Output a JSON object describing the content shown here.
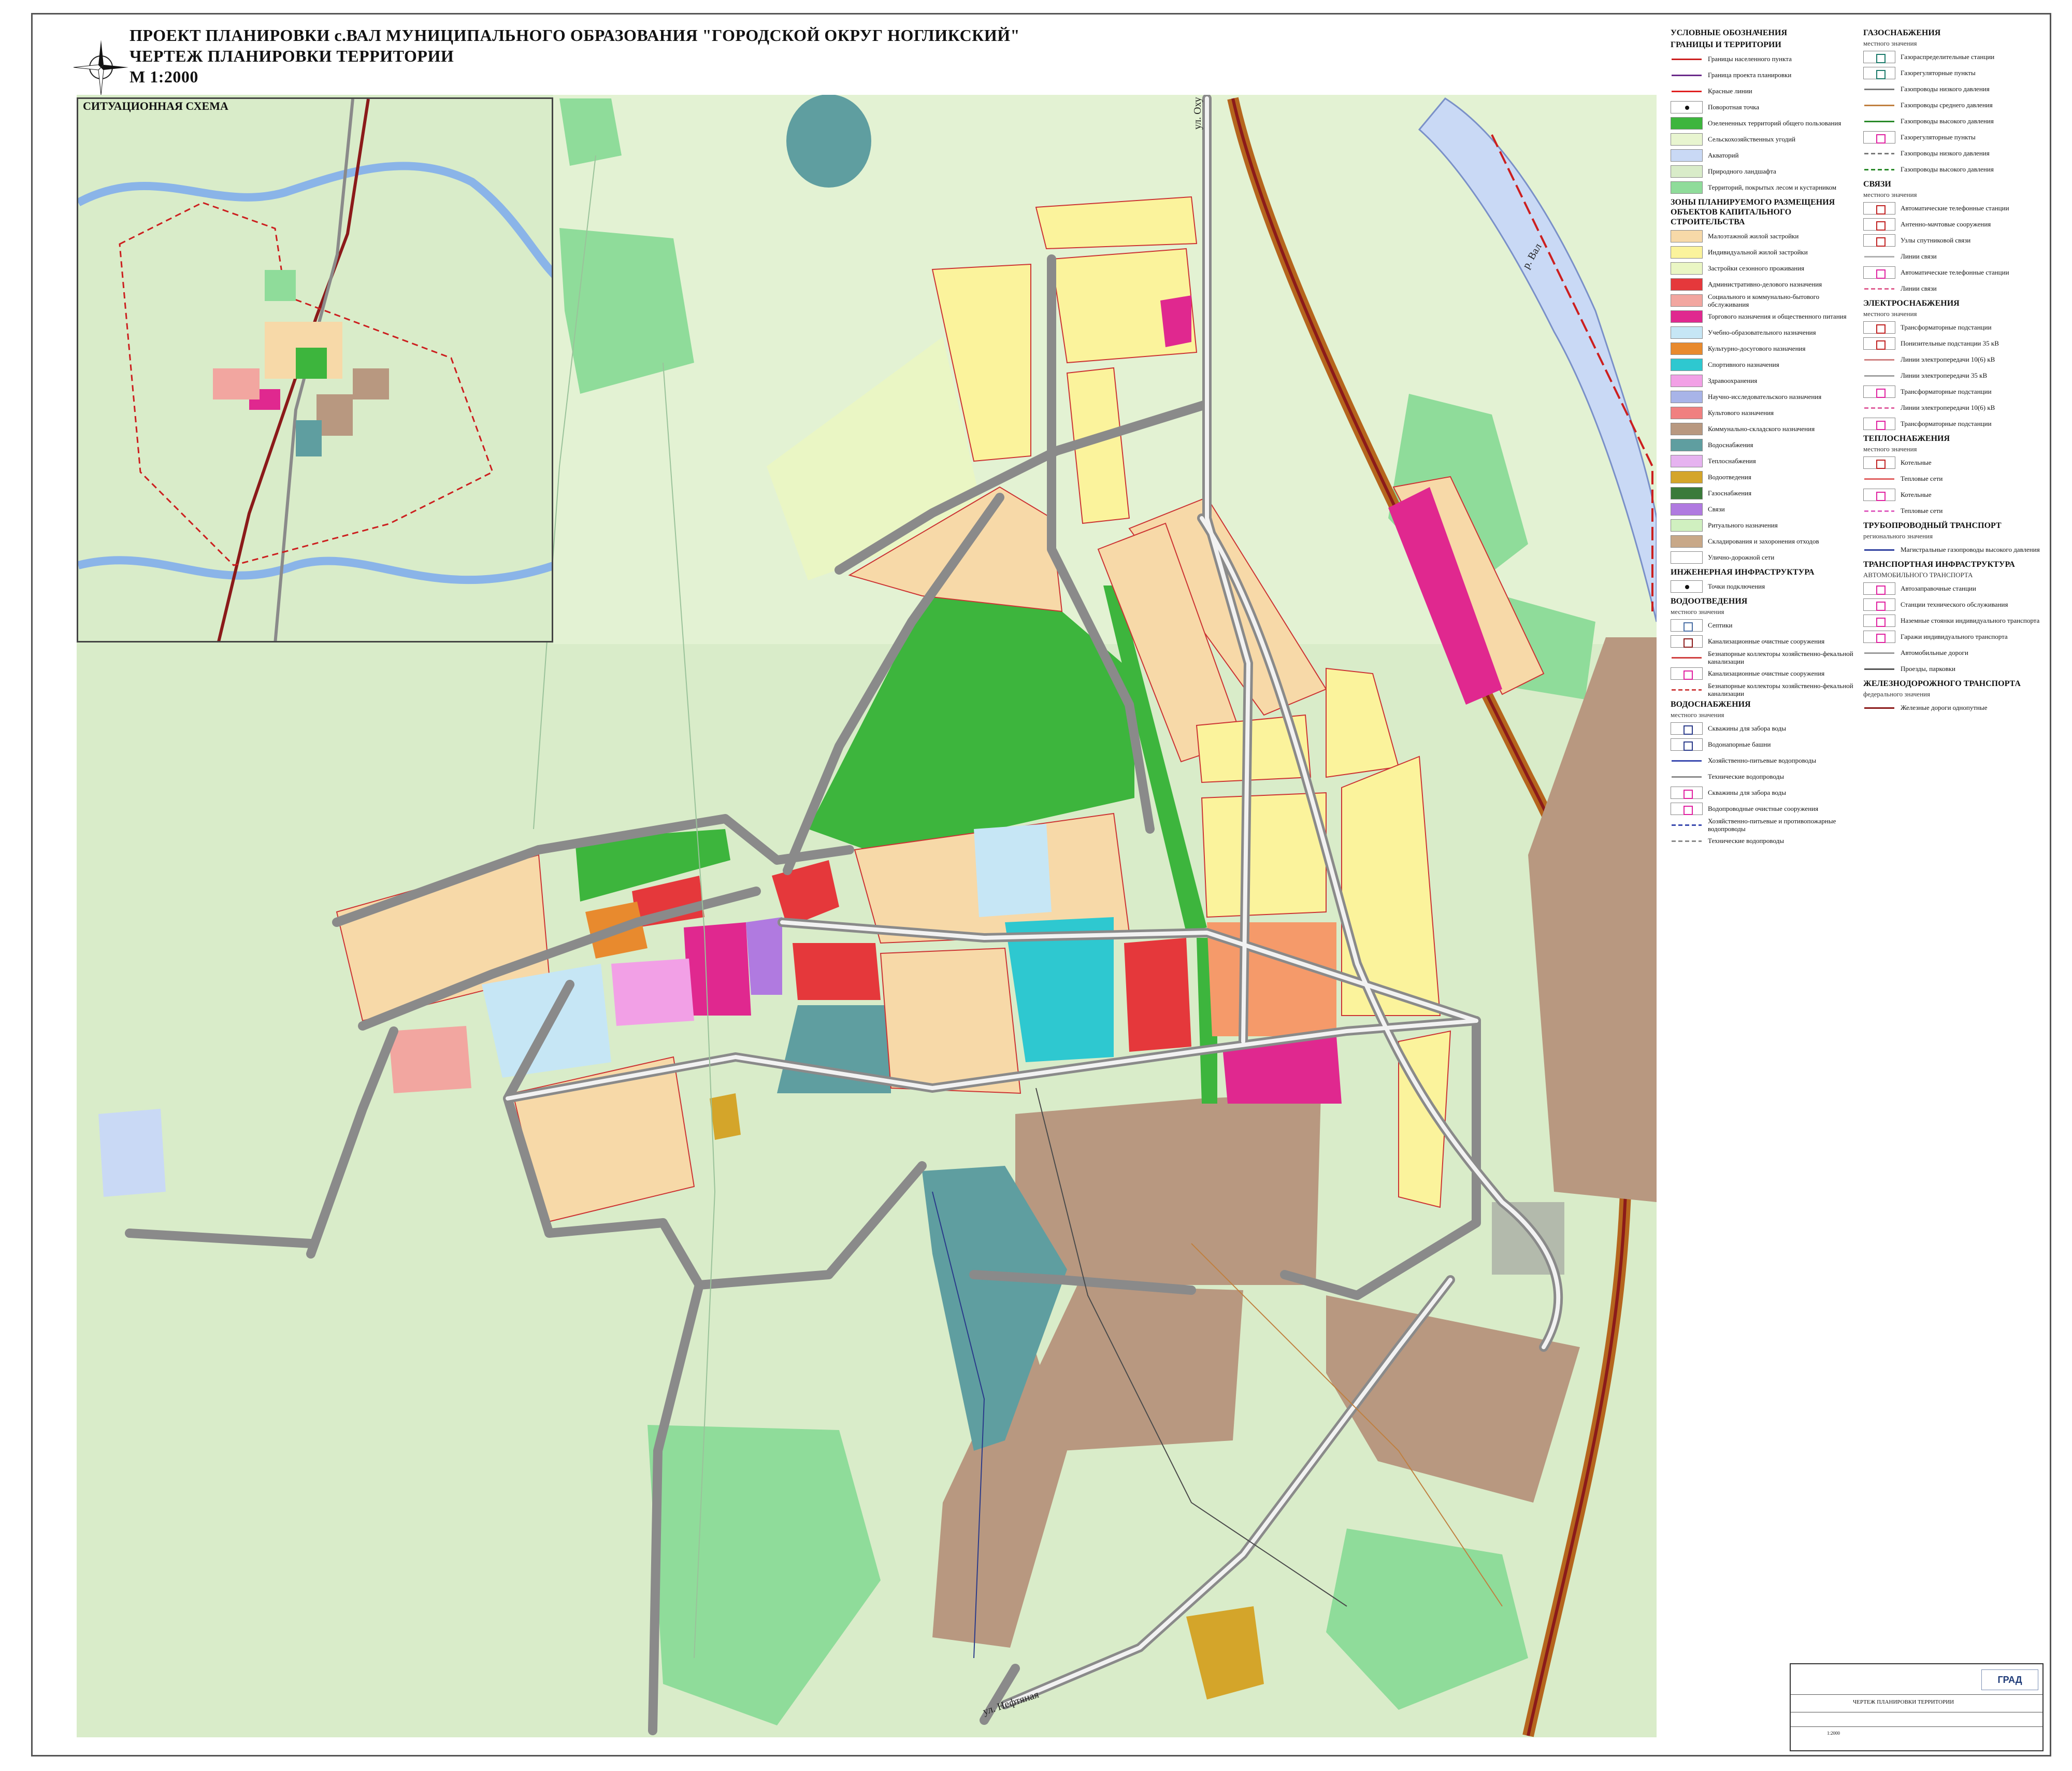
{
  "title": {
    "line1": "ПРОЕКТ ПЛАНИРОВКИ с.ВАЛ МУНИЦИПАЛЬНОГО ОБРАЗОВАНИЯ \"ГОРОДСКОЙ ОКРУГ НОГЛИКСКИЙ\"",
    "line2": "ЧЕРТЕЖ ПЛАНИРОВКИ ТЕРРИТОРИИ",
    "line3": "М 1:2000"
  },
  "inset": {
    "label": "СИТУАЦИОННАЯ СХЕМА"
  },
  "map_labels": {
    "road_north": "ул. Оху",
    "road_south": "ул. Нефтяная",
    "river": "р. Вал"
  },
  "legend": {
    "title": "УСЛОВНЫЕ ОБОЗНАЧЕНИЯ",
    "sections": [
      {
        "heading": "ГРАНИЦЫ И ТЕРРИТОРИИ",
        "items": [
          {
            "label": "Границы населенного пункта",
            "kind": "line",
            "color": "#cc1f1f"
          },
          {
            "label": "Граница проекта планировки",
            "kind": "line",
            "color": "#6a2a8a"
          },
          {
            "label": "Красные линии",
            "kind": "line",
            "color": "#e02020"
          },
          {
            "label": "Поворотная точка",
            "kind": "dot",
            "color": "#111111"
          },
          {
            "label": "Озелененных территорий общего пользования",
            "kind": "fill",
            "color": "#3db53d"
          },
          {
            "label": "Сельскохозяйственных угодий",
            "kind": "fill",
            "color": "#e8f5d0"
          },
          {
            "label": "Акваторий",
            "kind": "fill",
            "color": "#c9d9f5"
          },
          {
            "label": "Природного ландшафта",
            "kind": "fill",
            "color": "#d9ecc9"
          },
          {
            "label": "Территорий, покрытых лесом и кустарником",
            "kind": "fill",
            "color": "#8fdc9a"
          }
        ]
      },
      {
        "heading": "ЗОНЫ ПЛАНИРУЕМОГО РАЗМЕЩЕНИЯ ОБЪЕКТОВ КАПИТАЛЬНОГО СТРОИТЕЛЬСТВА",
        "items": [
          {
            "label": "Малоэтажной жилой застройки",
            "kind": "fill",
            "color": "#f7d9a8"
          },
          {
            "label": "Индивидуальной жилой застройки",
            "kind": "fill",
            "color": "#fbf39c"
          },
          {
            "label": "Застройки сезонного проживания",
            "kind": "fill",
            "color": "#eaf6c4"
          },
          {
            "label": "Административно-делового назначения",
            "kind": "fill",
            "color": "#e5383b"
          },
          {
            "label": "Социального и коммунально-бытового обслуживания",
            "kind": "fill",
            "color": "#f2a6a0"
          },
          {
            "label": "Торгового назначения и общественного питания",
            "kind": "fill",
            "color": "#e0288f"
          },
          {
            "label": "Учебно-образовательного назначения",
            "kind": "fill",
            "color": "#c6e6f5"
          },
          {
            "label": "Культурно-досугового назначения",
            "kind": "fill",
            "color": "#e88a2e"
          },
          {
            "label": "Спортивного назначения",
            "kind": "fill",
            "color": "#2ec8d0"
          },
          {
            "label": "Здравоохранения",
            "kind": "fill",
            "color": "#f2a0e6"
          },
          {
            "label": "Научно-исследовательского назначения",
            "kind": "fill",
            "color": "#a8b4e8"
          },
          {
            "label": "Культового назначения",
            "kind": "fill",
            "color": "#f08080"
          },
          {
            "label": "Коммунально-складского назначения",
            "kind": "fill",
            "color": "#b89880"
          },
          {
            "label": "Водоснабжения",
            "kind": "fill",
            "color": "#5f9ea0"
          },
          {
            "label": "Теплоснабжения",
            "kind": "fill",
            "color": "#e6b3f0"
          },
          {
            "label": "Водоотведения",
            "kind": "fill",
            "color": "#d4a52a"
          },
          {
            "label": "Газоснабжения",
            "kind": "fill",
            "color": "#3a7a3a"
          },
          {
            "label": "Связи",
            "kind": "fill",
            "color": "#b07ae0"
          },
          {
            "label": "Ритуального назначения",
            "kind": "fill",
            "color": "#d0f0c0"
          },
          {
            "label": "Складирования и захоронения отходов",
            "kind": "fill",
            "color": "#c8a888"
          },
          {
            "label": "Улично-дорожной сети",
            "kind": "fill",
            "color": "#ffffff"
          }
        ]
      },
      {
        "heading": "ИНЖЕНЕРНАЯ ИНФРАСТРУКТУРА",
        "items": [
          {
            "label": "Точки подключения",
            "kind": "dot",
            "color": "#111111"
          }
        ]
      },
      {
        "heading": "ВОДООТВЕДЕНИЯ",
        "sub": "местного значения",
        "items": [
          {
            "label": "Септики",
            "kind": "sym",
            "color": "#4a6fa5"
          },
          {
            "label": "Канализационные очистные сооружения",
            "kind": "sym",
            "color": "#8b1a1a"
          },
          {
            "label": "Безнапорные коллекторы хозяйственно-фекальной канализации",
            "kind": "line",
            "color": "#d04040"
          },
          {
            "label": "Канализационные очистные сооружения",
            "kind": "sym",
            "color": "#e020a0"
          },
          {
            "label": "Безнапорные коллекторы хозяйственно-фекальной канализации",
            "kind": "dashed",
            "color": "#d04040"
          }
        ]
      },
      {
        "heading": "ВОДОСНАБЖЕНИЯ",
        "sub": "местного значения",
        "items": [
          {
            "label": "Скважины для забора воды",
            "kind": "sym",
            "color": "#2a3a8a"
          },
          {
            "label": "Водонапорные башни",
            "kind": "sym",
            "color": "#2a3a8a"
          },
          {
            "label": "Хозяйственно-питьевые водопроводы",
            "kind": "line",
            "color": "#3a4ab0"
          },
          {
            "label": "Технические водопроводы",
            "kind": "line",
            "color": "#8a8a8a"
          },
          {
            "label": "Скважины для забора воды",
            "kind": "sym",
            "color": "#e020a0"
          },
          {
            "label": "Водопроводные очистные сооружения",
            "kind": "sym",
            "color": "#e020a0"
          },
          {
            "label": "Хозяйственно-питьевые и противопожарные водопроводы",
            "kind": "dashed",
            "color": "#3a4ab0"
          },
          {
            "label": "Технические водопроводы",
            "kind": "dashed",
            "color": "#8a8a8a"
          }
        ]
      }
    ],
    "sections2": [
      {
        "heading": "ГАЗОСНАБЖЕНИЯ",
        "sub": "местного значения",
        "items": [
          {
            "label": "Газораспределительные станции",
            "kind": "sym",
            "color": "#1a7a6a"
          },
          {
            "label": "Газорегуляторные пункты",
            "kind": "sym",
            "color": "#1a7a6a"
          },
          {
            "label": "Газопроводы низкого давления",
            "kind": "line",
            "color": "#7a7a7a"
          },
          {
            "label": "Газопроводы среднего давления",
            "kind": "line",
            "color": "#c08040"
          },
          {
            "label": "Газопроводы высокого давления",
            "kind": "line",
            "color": "#2a8a2a"
          },
          {
            "label": "Газорегуляторные пункты",
            "kind": "sym",
            "color": "#e020a0"
          },
          {
            "label": "Газопроводы низкого давления",
            "kind": "dashed",
            "color": "#7a7a7a"
          },
          {
            "label": "Газопроводы высокого давления",
            "kind": "dashed",
            "color": "#2a8a2a"
          }
        ]
      },
      {
        "heading": "СВЯЗИ",
        "sub": "местного значения",
        "items": [
          {
            "label": "Автоматические телефонные станции",
            "kind": "sym",
            "color": "#c02020"
          },
          {
            "label": "Антенно-мачтовые сооружения",
            "kind": "sym",
            "color": "#c02020"
          },
          {
            "label": "Узлы спутниковой связи",
            "kind": "sym",
            "color": "#c02020"
          },
          {
            "label": "Линии связи",
            "kind": "line",
            "color": "#b0b0b0"
          },
          {
            "label": "Автоматические телефонные станции",
            "kind": "sym",
            "color": "#e020a0"
          },
          {
            "label": "Линии связи",
            "kind": "dashed",
            "color": "#e06090"
          }
        ]
      },
      {
        "heading": "ЭЛЕКТРОСНАБЖЕНИЯ",
        "sub": "местного значения",
        "items": [
          {
            "label": "Трансформаторные подстанции",
            "kind": "sym",
            "color": "#c02020"
          },
          {
            "label": "Понизительные подстанции 35 кВ",
            "kind": "sym",
            "color": "#c02020"
          },
          {
            "label": "Линии электропередачи 10(6) кВ",
            "kind": "line",
            "color": "#d08080"
          },
          {
            "label": "Линии электропередачи 35 кВ",
            "kind": "line",
            "color": "#a0a0a0"
          },
          {
            "label": "Трансформаторные подстанции",
            "kind": "sym",
            "color": "#e020a0"
          },
          {
            "label": "Линии электропередачи 10(6) кВ",
            "kind": "dashed",
            "color": "#e060a0"
          },
          {
            "label": "Трансформаторные подстанции",
            "kind": "sym",
            "color": "#e020a0"
          }
        ]
      },
      {
        "heading": "ТЕПЛОСНАБЖЕНИЯ",
        "sub": "местного значения",
        "items": [
          {
            "label": "Котельные",
            "kind": "sym",
            "color": "#c02020"
          },
          {
            "label": "Тепловые сети",
            "kind": "line",
            "color": "#e06060"
          },
          {
            "label": "Котельные",
            "kind": "sym",
            "color": "#e020a0"
          },
          {
            "label": "Тепловые сети",
            "kind": "dashed",
            "color": "#e060c0"
          }
        ]
      },
      {
        "heading": "ТРУБОПРОВОДНЫЙ ТРАНСПОРТ",
        "sub": "регионального значения",
        "items": [
          {
            "label": "Магистральные газопроводы высокого давления",
            "kind": "line",
            "color": "#3040a0"
          }
        ]
      },
      {
        "heading": "ТРАНСПОРТНАЯ ИНФРАСТРУКТУРА",
        "sub": "АВТОМОБИЛЬНОГО ТРАНСПОРТА",
        "items": [
          {
            "label": "Автозаправочные станции",
            "kind": "sym",
            "color": "#e020a0"
          },
          {
            "label": "Станции технического обслуживания",
            "kind": "sym",
            "color": "#e020a0"
          },
          {
            "label": "Наземные стоянки индивидуального транспорта",
            "kind": "sym",
            "color": "#e020a0"
          },
          {
            "label": "Гаражи индивидуального транспорта",
            "kind": "sym",
            "color": "#e020a0"
          },
          {
            "label": "Автомобильные дороги",
            "kind": "line",
            "color": "#9a9a9a"
          },
          {
            "label": "Проезды, парковки",
            "kind": "line",
            "color": "#555555"
          }
        ]
      },
      {
        "heading": "ЖЕЛЕЗНОДОРОЖНОГО ТРАНСПОРТА",
        "sub": "федерального значения",
        "items": [
          {
            "label": "Железные дороги однопутные",
            "kind": "line",
            "color": "#8b1a1a"
          }
        ]
      }
    ]
  },
  "stamp": {
    "sheet_name": "ЧЕРТЕЖ ПЛАНИРОВКИ ТЕРРИТОРИИ",
    "scale": "1:2000",
    "logo": "ГРАД"
  }
}
